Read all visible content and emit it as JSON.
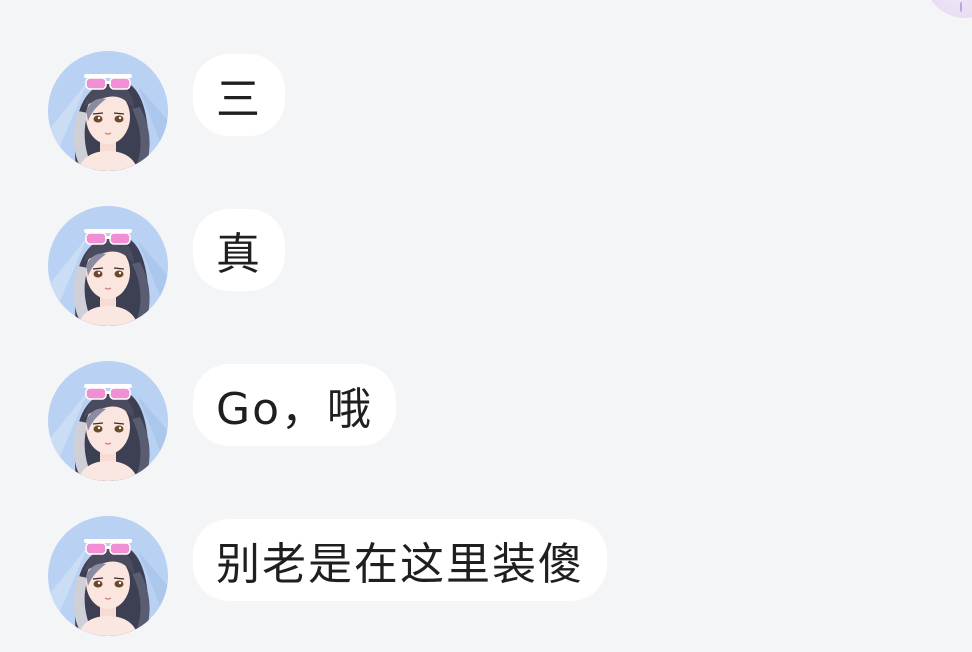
{
  "chat": {
    "messages": [
      {
        "text": "三",
        "avatar_icon": "anime-girl-avatar-icon"
      },
      {
        "text": "真",
        "avatar_icon": "anime-girl-avatar-icon"
      },
      {
        "text": "Go，哦",
        "avatar_icon": "anime-girl-avatar-icon"
      },
      {
        "text": "别老是在这里装傻",
        "avatar_icon": "anime-girl-avatar-icon"
      }
    ],
    "corner_avatar_icon": "self-avatar-icon"
  },
  "colors": {
    "background": "#f4f5f7",
    "bubble": "#ffffff",
    "text": "#1f1f1f",
    "avatar_bg": "#b9d1f2",
    "sunglasses": "#f08fd3"
  }
}
